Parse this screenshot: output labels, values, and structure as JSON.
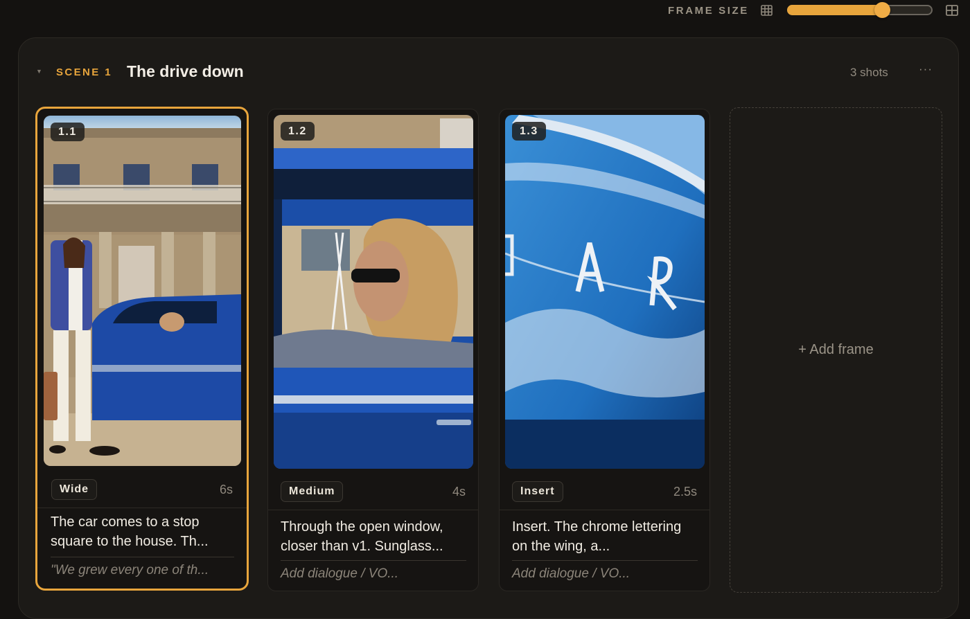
{
  "toolbar": {
    "frame_size_label": "FRAME SIZE",
    "frame_size_value": 0.65,
    "small_grid_icon": "grid-3x3-icon",
    "large_grid_icon": "grid-2x2-icon",
    "accent_color": "#e8a53c"
  },
  "scene": {
    "collapse_icon": "caret-down-icon",
    "label": "SCENE 1",
    "title": "The drive down",
    "shot_count": "3 shots",
    "more_label": "···"
  },
  "frames": [
    {
      "number": "1.1",
      "shot_type": "Wide",
      "duration": "6s",
      "description": "The car comes to a stop square to the house. Th...",
      "dialogue": "\"We grew every one of th...",
      "selected": true
    },
    {
      "number": "1.2",
      "shot_type": "Medium",
      "duration": "4s",
      "description": "Through the open window, closer than v1. Sunglass...",
      "dialogue": "Add dialogue / VO...",
      "selected": false
    },
    {
      "number": "1.3",
      "shot_type": "Insert",
      "duration": "2.5s",
      "description": "Insert. The chrome lettering on the wing, a...",
      "dialogue": "Add dialogue / VO...",
      "selected": false
    }
  ],
  "add_frame": {
    "label": "+ Add frame"
  }
}
